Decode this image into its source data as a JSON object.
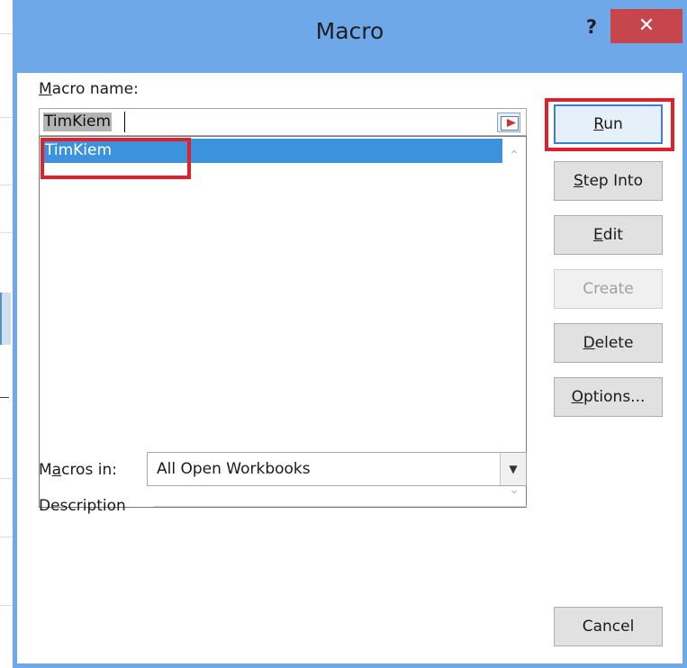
{
  "window": {
    "title": "Macro",
    "help_glyph": "?",
    "close_glyph": "✕"
  },
  "macro_name": {
    "label_prefix": "",
    "label_underlined": "M",
    "label_rest": "acro name:",
    "value": "TimKiem"
  },
  "macro_list": {
    "items": [
      "TimKiem"
    ],
    "selected": "TimKiem"
  },
  "macros_in": {
    "label_prefix": "M",
    "label_underlined": "a",
    "label_rest": "cros in:",
    "value": "All Open Workbooks"
  },
  "description": {
    "label": "Description"
  },
  "buttons": {
    "run": {
      "u": "R",
      "rest": "un"
    },
    "step_into": {
      "u": "S",
      "rest": "tep Into"
    },
    "edit": {
      "u": "E",
      "rest": "dit"
    },
    "create": {
      "label": "Create"
    },
    "delete": {
      "u": "D",
      "rest": "elete"
    },
    "options": {
      "u": "O",
      "rest": "ptions..."
    },
    "cancel": {
      "label": "Cancel"
    }
  },
  "colors": {
    "title_bar": "#6fa8e8",
    "close_button": "#c7464c",
    "selection": "#3c92dc",
    "highlight_box": "#e0202a"
  },
  "icons": [
    "help-icon",
    "close-icon",
    "collapse-dialog-icon",
    "scroll-up-icon",
    "scroll-down-icon",
    "dropdown-chevron-icon"
  ]
}
